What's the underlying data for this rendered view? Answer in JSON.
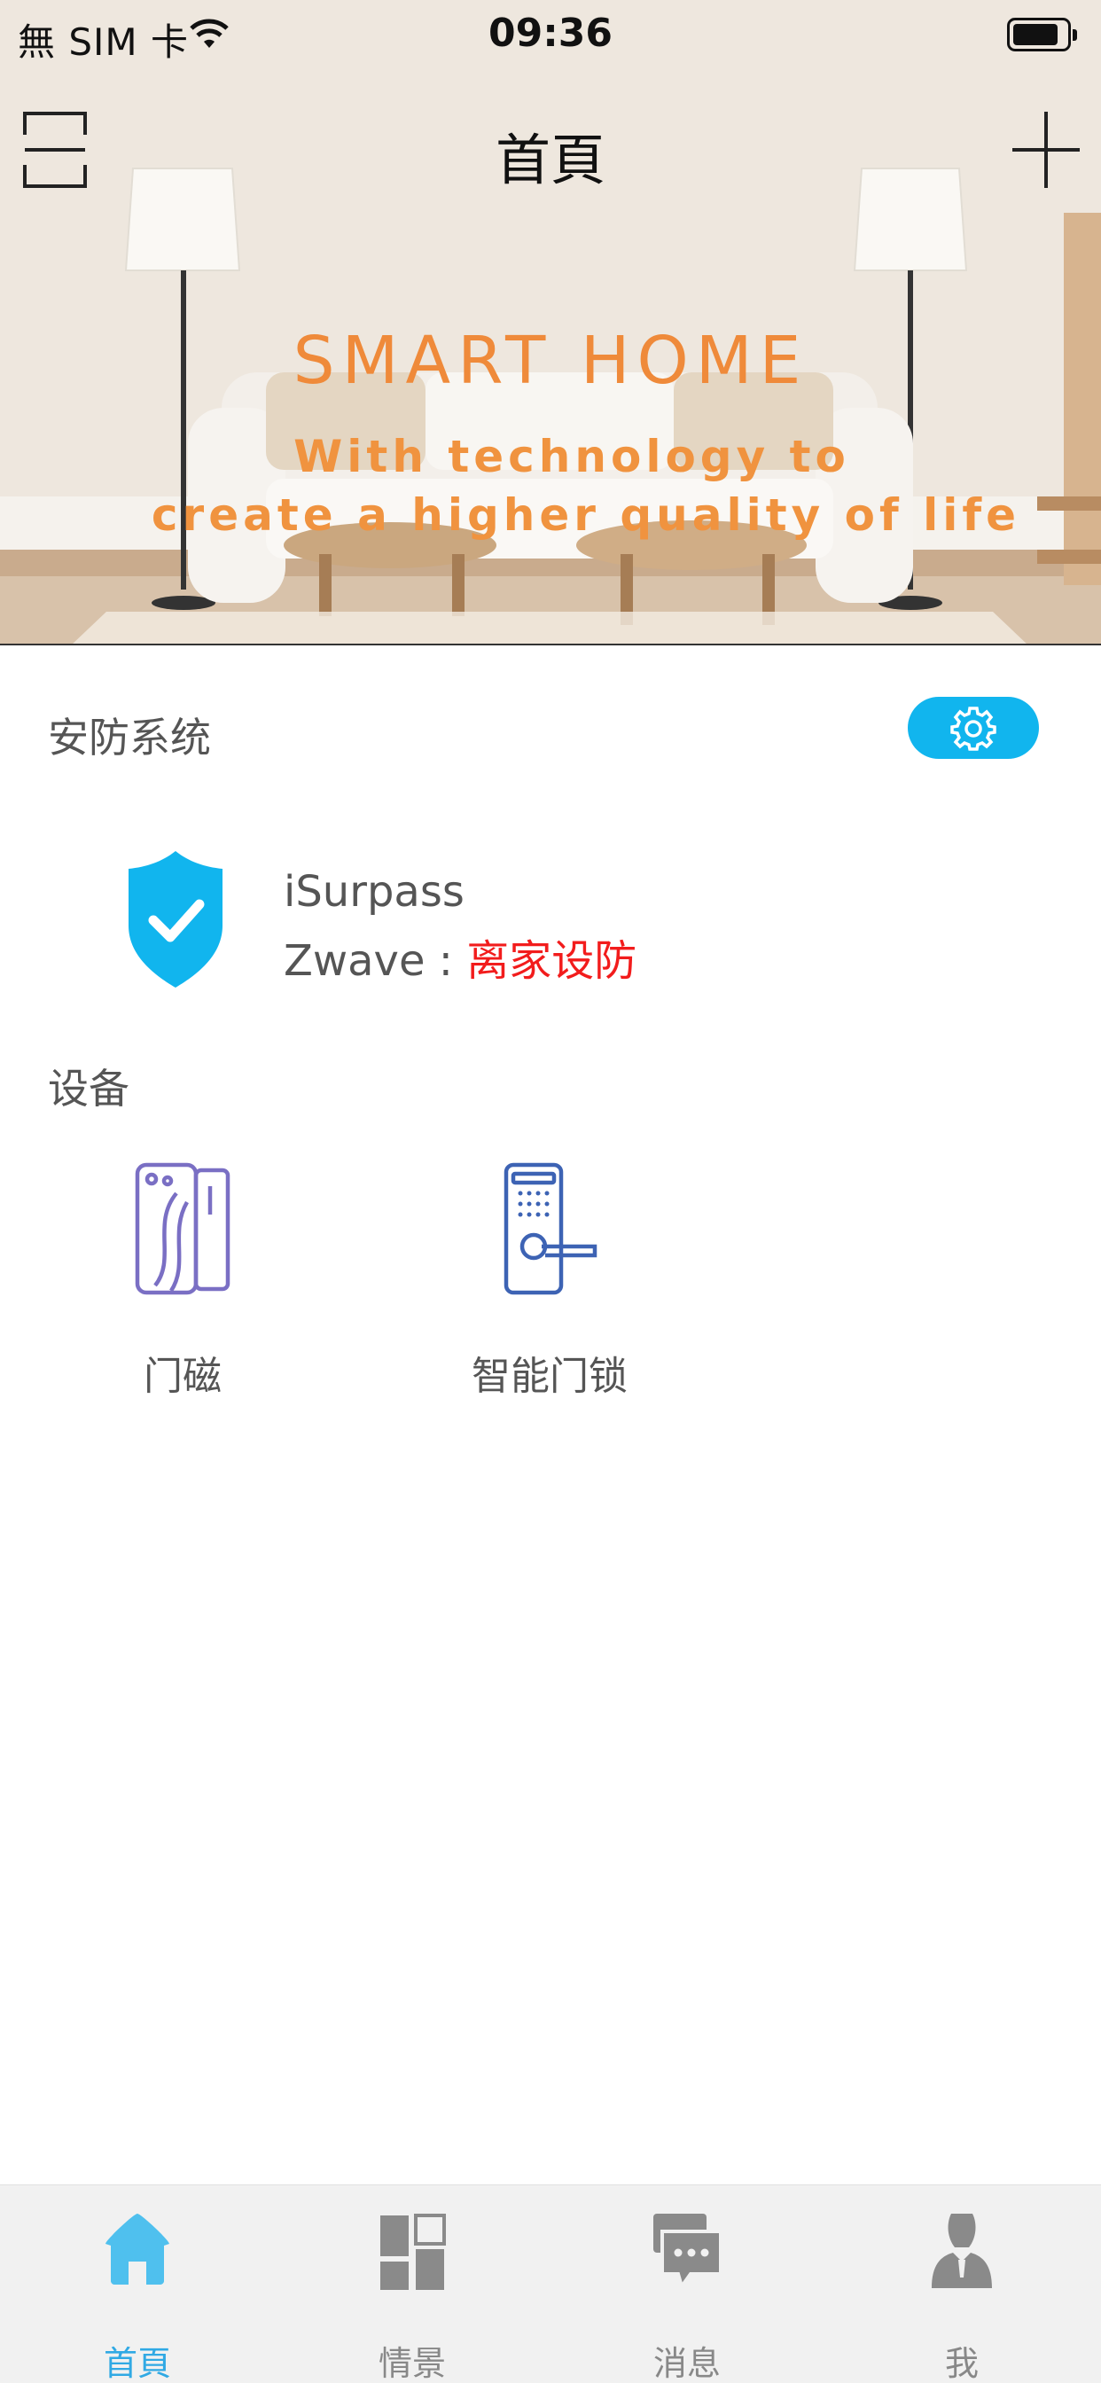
{
  "status_bar": {
    "carrier": "無 SIM 卡",
    "time": "09:36"
  },
  "nav": {
    "title": "首頁",
    "left_icon": "scan-icon",
    "right_icon": "add-icon"
  },
  "hero": {
    "title": "SMART HOME",
    "subtitle_line1": "With technology to",
    "subtitle_line2": "create a higher quality of life",
    "accent_color": "#ef8a3a"
  },
  "security": {
    "section_title": "安防系统",
    "settings_icon": "gear-icon",
    "system_name": "iSurpass",
    "mode_label": "Zwave : ",
    "mode_value": "离家设防",
    "mode_color": "#f21c1c",
    "shield_color": "#11b5ee"
  },
  "devices": {
    "section_title": "设备",
    "items": [
      {
        "label": "门磁",
        "icon": "door-sensor-icon"
      },
      {
        "label": "智能门锁",
        "icon": "smart-lock-icon"
      }
    ]
  },
  "tabbar": {
    "active_color": "#30a9e4",
    "inactive_color": "#888888",
    "tabs": [
      {
        "label": "首頁",
        "icon": "home-icon",
        "active": true
      },
      {
        "label": "情景",
        "icon": "scene-grid-icon",
        "active": false
      },
      {
        "label": "消息",
        "icon": "message-icon",
        "active": false
      },
      {
        "label": "我",
        "icon": "user-icon",
        "active": false
      }
    ]
  }
}
